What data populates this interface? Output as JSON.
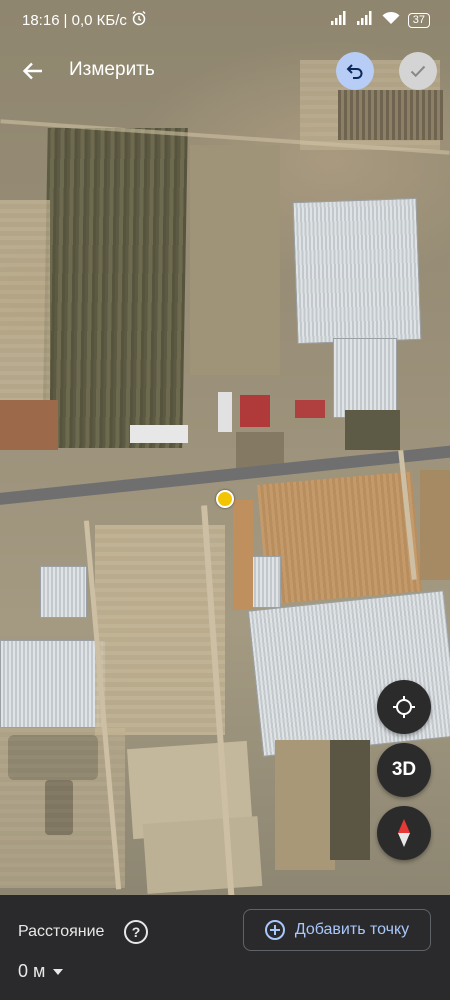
{
  "status_bar": {
    "time": "18:16",
    "network_speed": "| 0,0 КБ/с",
    "battery": "37",
    "icons": [
      "alarm-icon",
      "signal-icon",
      "signal-icon",
      "wifi-icon",
      "battery-icon"
    ]
  },
  "app_bar": {
    "back_icon": "arrow-left-icon",
    "title": "Измерить",
    "undo_icon": "undo-icon",
    "done_icon": "check-icon"
  },
  "map": {
    "type": "satellite",
    "controls": [
      {
        "name": "my-location-icon"
      },
      {
        "name": "3d",
        "label": "3D"
      },
      {
        "name": "compass-icon"
      }
    ],
    "pin_color": "#f3c400"
  },
  "bottom_panel": {
    "distance_label": "Расстояние",
    "help_icon": "help-circle-icon",
    "distance_value": "0 м",
    "add_point_label": "Добавить точку",
    "add_point_icon": "plus-circle-icon"
  },
  "colors": {
    "accent": "#a8c7fa",
    "undo_bg": "#b8cdf5",
    "panel_bg": "#2a2a2c"
  }
}
